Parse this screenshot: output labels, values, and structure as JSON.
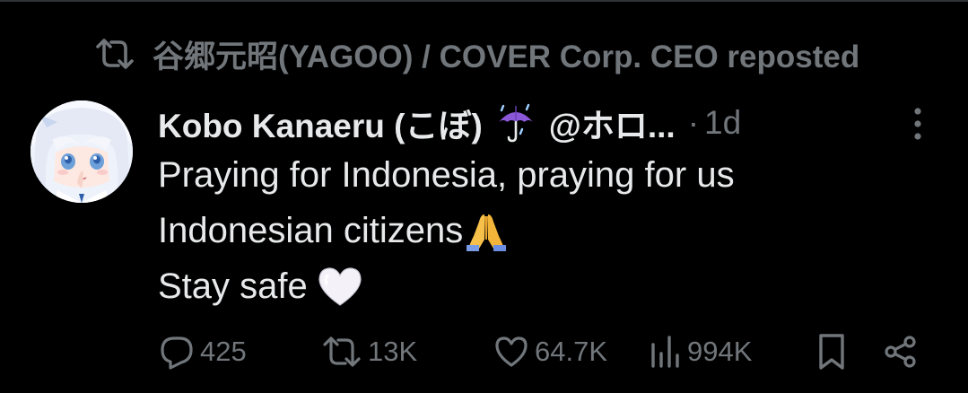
{
  "repost": {
    "text": "谷郷元昭(YAGOO) / COVER Corp. CEO reposted",
    "icon": "repost-icon"
  },
  "post": {
    "display_name": "Kobo Kanaeru (こぼ)",
    "name_emoji": "umbrella-with-rain-emoji",
    "handle": "@ホロ...",
    "separator": "·",
    "time": "1d",
    "avatar": "avatar-anime-girl",
    "text_lines": [
      "Praying for Indonesia, praying for us",
      "Indonesian citizens",
      "Stay safe"
    ],
    "emojis": [
      "folded-hands-emoji",
      "white-heart-emoji"
    ]
  },
  "actions": {
    "replies": "425",
    "reposts": "13K",
    "likes": "64.7K",
    "views": "994K"
  },
  "colors": {
    "background": "#000000",
    "text": "#e7e9ea",
    "muted": "#71767b",
    "divider": "#2f3336"
  }
}
